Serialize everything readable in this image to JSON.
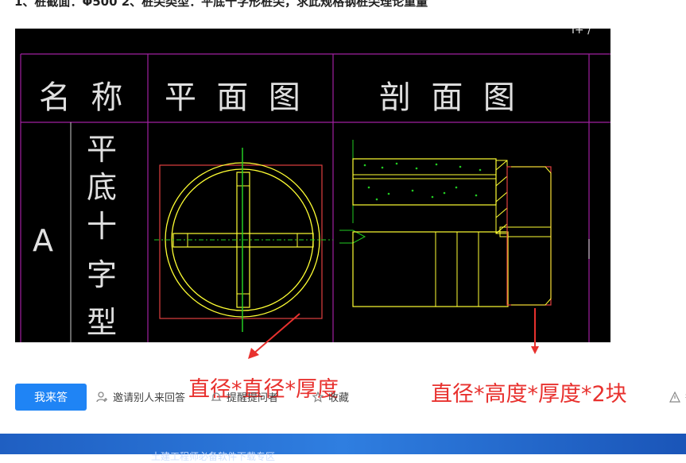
{
  "question": {
    "title": "1、桩截面：Φ500 2、桩尖类型：平底十字形桩尖，求此规格钢桩尖理论重量"
  },
  "drawing": {
    "header_name": "名  称",
    "header_plan": "平  面  图",
    "header_section": "剖  面  图",
    "row_label": "A",
    "type_chars": [
      "平",
      "底",
      "十",
      "字",
      "型"
    ],
    "top_right_fragment": "i+ /",
    "colors": {
      "frame": "#a020a0",
      "cad_text": "#e0e0e0",
      "yellow": "#ffff33",
      "green": "#22cc22",
      "red_box": "#e04040"
    }
  },
  "annotations": {
    "left": "直径*直径*厚度",
    "right": "直径*高度*厚度*2块",
    "color": "#e8312e"
  },
  "actions": {
    "answer_label": "我来答",
    "invite_label": "邀请别人来回答",
    "remind_label": "提醒提问者",
    "favorite_label": "收藏",
    "report_label": "举"
  },
  "footer": {
    "text": "土建工程师必备软件下载专区"
  }
}
